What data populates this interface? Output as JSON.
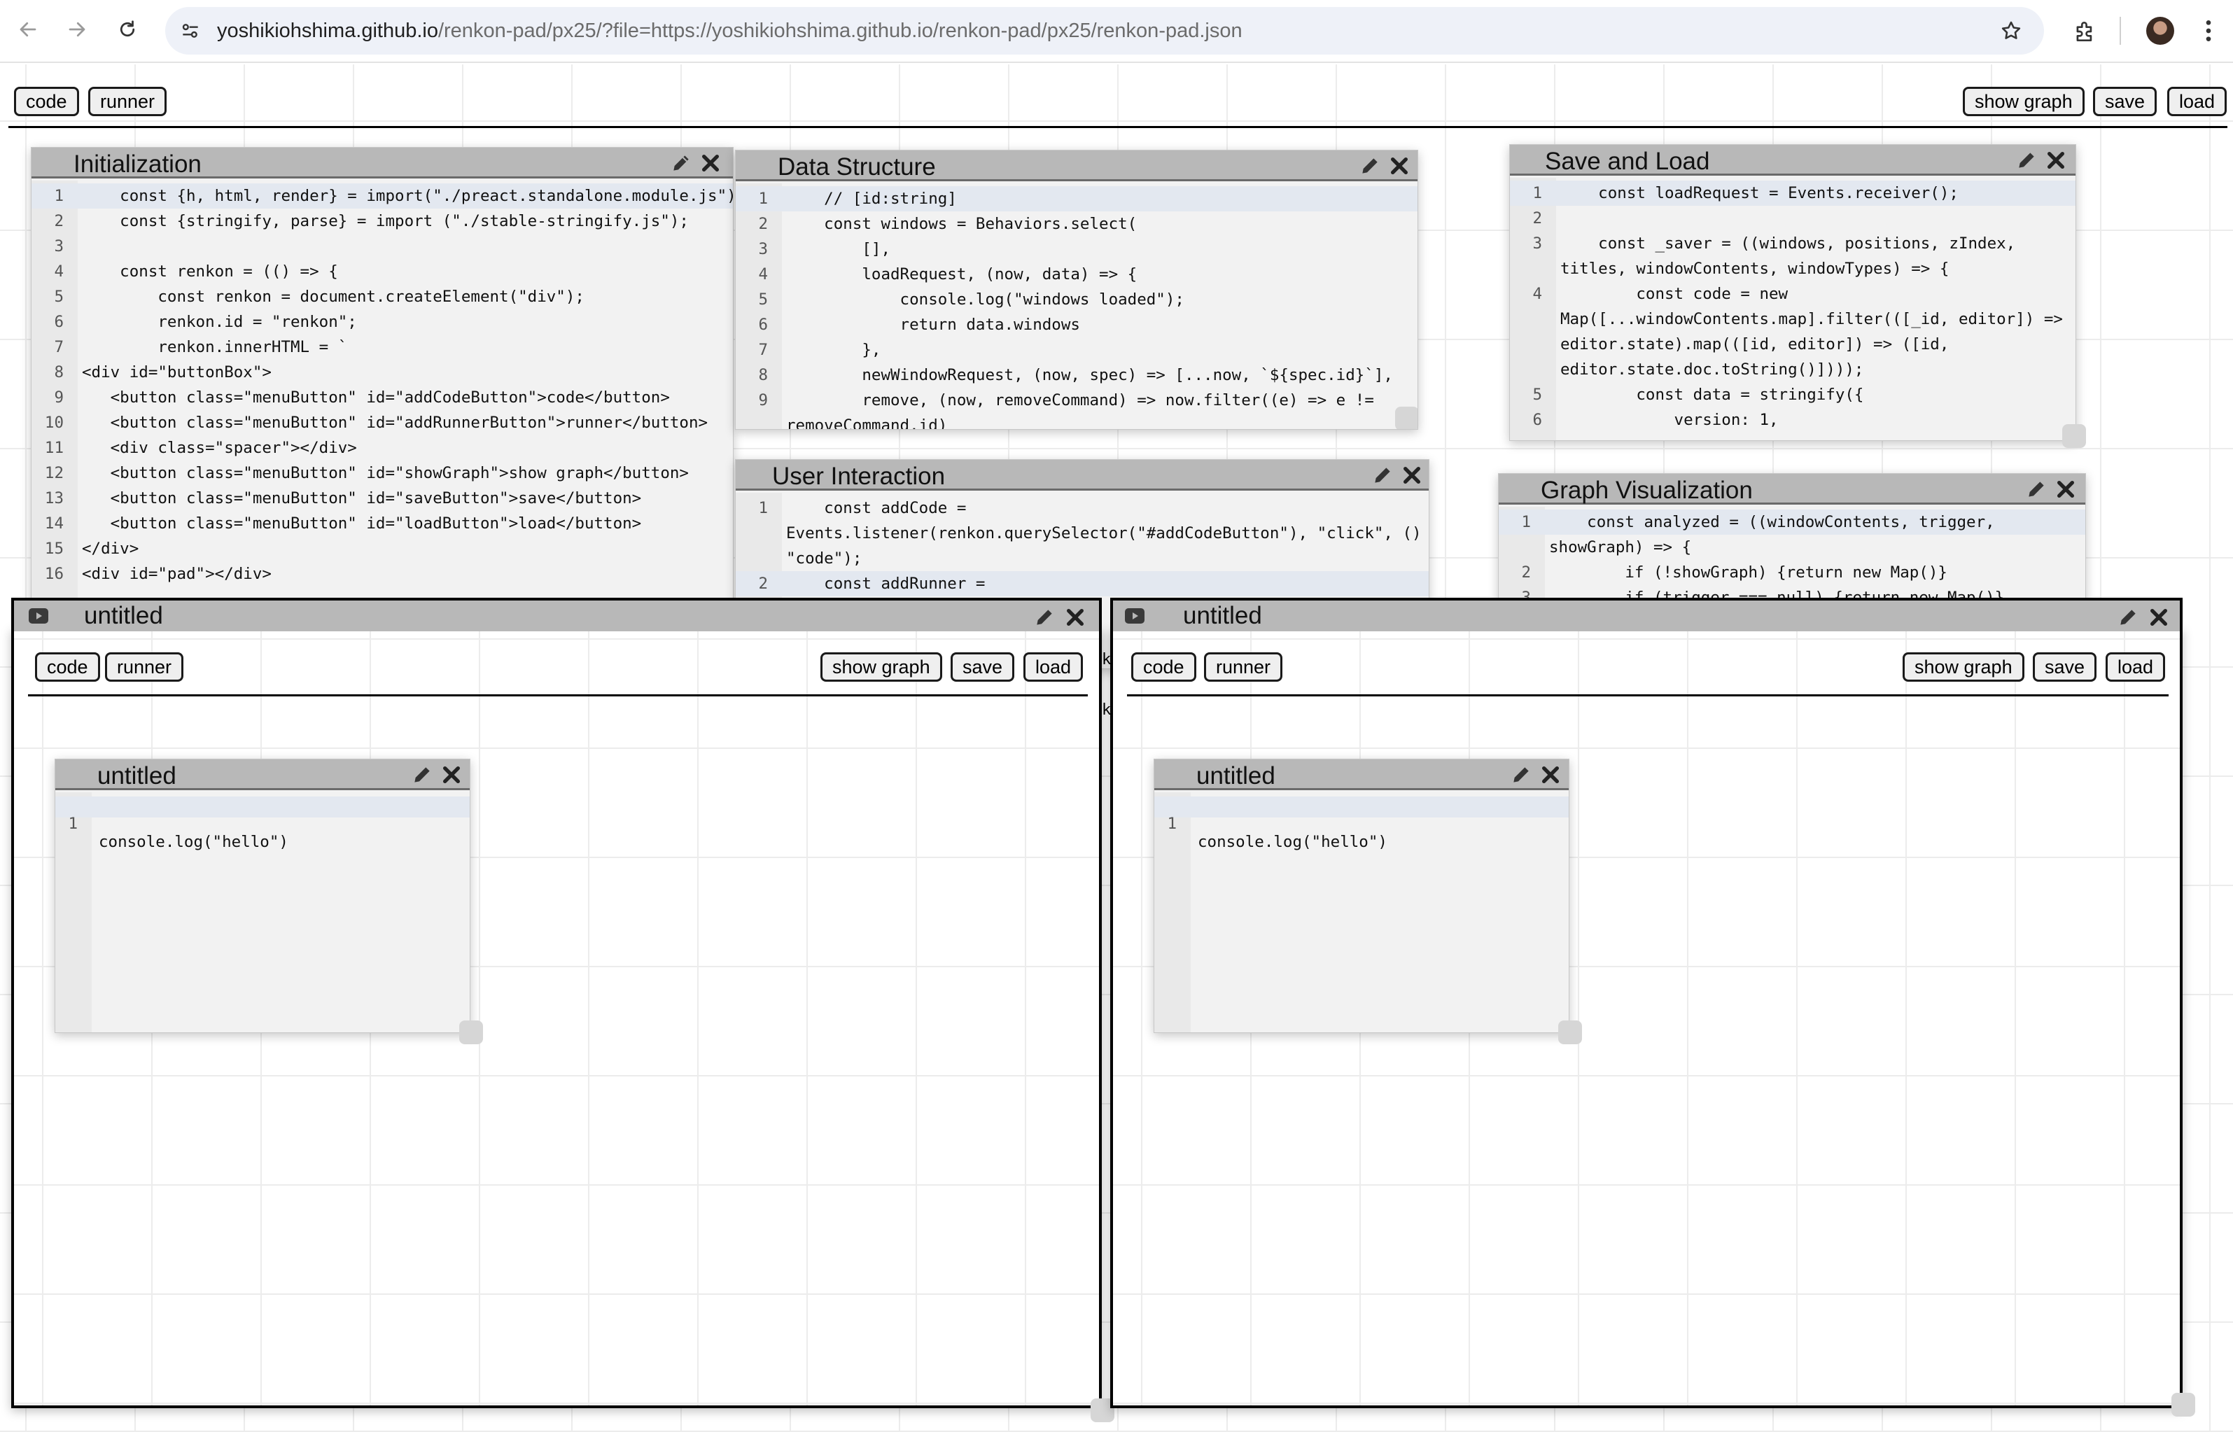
{
  "browser": {
    "url_host": "yoshikiohshima.github.io",
    "url_path": "/renkon-pad/px25/?file=https://yoshikiohshima.github.io/renkon-pad/px25/renkon-pad.json",
    "icons": [
      "back-icon",
      "forward-icon",
      "reload-icon",
      "site-info-icon",
      "bookmark-star-icon",
      "extensions-icon",
      "profile-avatar",
      "more-menu-icon"
    ]
  },
  "toolbar": {
    "code_label": "code",
    "runner_label": "runner",
    "show_graph_label": "show graph",
    "save_label": "save",
    "load_label": "load"
  },
  "windows": {
    "initialization": {
      "title": "Initialization",
      "lines": [
        {
          "n": "1",
          "t": "    const {h, html, render} = import(\"./preact.standalone.module.js\");"
        },
        {
          "n": "2",
          "t": "    const {stringify, parse} = import (\"./stable-stringify.js\");"
        },
        {
          "n": "3",
          "t": ""
        },
        {
          "n": "4",
          "t": "    const renkon = (() => {"
        },
        {
          "n": "5",
          "t": "        const renkon = document.createElement(\"div\");"
        },
        {
          "n": "6",
          "t": "        renkon.id = \"renkon\";"
        },
        {
          "n": "7",
          "t": "        renkon.innerHTML = `"
        },
        {
          "n": "8",
          "t": "<div id=\"buttonBox\">"
        },
        {
          "n": "9",
          "t": "   <button class=\"menuButton\" id=\"addCodeButton\">code</button>"
        },
        {
          "n": "10",
          "t": "   <button class=\"menuButton\" id=\"addRunnerButton\">runner</button>"
        },
        {
          "n": "11",
          "t": "   <div class=\"spacer\"></div>"
        },
        {
          "n": "12",
          "t": "   <button class=\"menuButton\" id=\"showGraph\">show graph</button>"
        },
        {
          "n": "13",
          "t": "   <button class=\"menuButton\" id=\"saveButton\">save</button>"
        },
        {
          "n": "14",
          "t": "   <button class=\"menuButton\" id=\"loadButton\">load</button>"
        },
        {
          "n": "15",
          "t": "</div>"
        },
        {
          "n": "16",
          "t": "<div id=\"pad\"></div>"
        }
      ]
    },
    "data_structure": {
      "title": "Data Structure",
      "lines": [
        {
          "n": "1",
          "t": "    // [id:string]"
        },
        {
          "n": "2",
          "t": "    const windows = Behaviors.select("
        },
        {
          "n": "3",
          "t": "        [],"
        },
        {
          "n": "4",
          "t": "        loadRequest, (now, data) => {"
        },
        {
          "n": "5",
          "t": "            console.log(\"windows loaded\");"
        },
        {
          "n": "6",
          "t": "            return data.windows"
        },
        {
          "n": "7",
          "t": "        },"
        },
        {
          "n": "8",
          "t": "        newWindowRequest, (now, spec) => [...now, `${spec.id}`],"
        },
        {
          "n": "9",
          "t": "        remove, (now, removeCommand) => now.filter((e) => e !="
        },
        {
          "n": "",
          "t": "removeCommand.id)"
        }
      ]
    },
    "save_and_load": {
      "title": "Save and Load",
      "lines": [
        {
          "n": "1",
          "t": "    const loadRequest = Events.receiver();"
        },
        {
          "n": "2",
          "t": ""
        },
        {
          "n": "3",
          "t": "    const _saver = ((windows, positions, zIndex,"
        },
        {
          "n": "",
          "t": "titles, windowContents, windowTypes) => {"
        },
        {
          "n": "4",
          "t": "        const code = new"
        },
        {
          "n": "",
          "t": "Map([...windowContents.map].filter(([_id, editor]) =>"
        },
        {
          "n": "",
          "t": "editor.state).map(([id, editor]) => ([id,"
        },
        {
          "n": "",
          "t": "editor.state.doc.toString()])));"
        },
        {
          "n": "5",
          "t": "        const data = stringify({"
        },
        {
          "n": "6",
          "t": "            version: 1,"
        }
      ]
    },
    "user_interaction": {
      "title": "User Interaction",
      "lines": [
        {
          "n": "1",
          "t": "    const addCode ="
        },
        {
          "n": "",
          "t": "Events.listener(renkon.querySelector(\"#addCodeButton\"), \"click\", () =>"
        },
        {
          "n": "",
          "t": "\"code\");"
        },
        {
          "n": "2",
          "t": "    const addRunner ="
        }
      ]
    },
    "graph_visualization": {
      "title": "Graph Visualization",
      "lines": [
        {
          "n": "1",
          "t": "    const analyzed = ((windowContents, trigger,"
        },
        {
          "n": "",
          "t": "showGraph) => {"
        },
        {
          "n": "2",
          "t": "        if (!showGraph) {return new Map()}"
        },
        {
          "n": "3",
          "t": "        if (trigger === null) {return new Map()}"
        }
      ]
    }
  },
  "runners": {
    "left": {
      "title": "untitled",
      "inner_title": "untitled",
      "inner_line_number": "1",
      "inner_code": "console.log(\"hello\")"
    },
    "right": {
      "title": "untitled",
      "inner_title": "untitled",
      "inner_line_number": "1",
      "inner_code": "console.log(\"hello\")"
    }
  },
  "peek_text": {
    "k1": "k",
    "k2": "k"
  }
}
